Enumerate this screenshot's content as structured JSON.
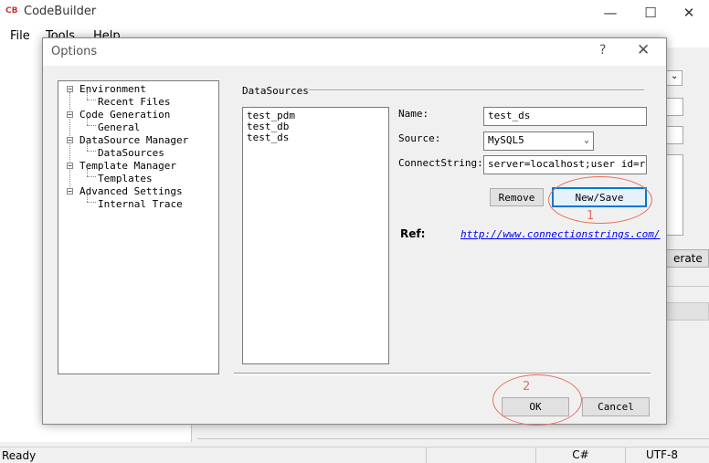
{
  "app": {
    "title": "CodeBuilder",
    "icon_text": "CB",
    "window_controls": {
      "minimize": "—",
      "maximize": "☐",
      "close": "✕"
    }
  },
  "menu": [
    "File",
    "Tools",
    "Help"
  ],
  "background": {
    "generate_button_partial": "erate"
  },
  "status_bar": {
    "status": "Ready",
    "language": "C#",
    "encoding": "UTF-8"
  },
  "dialog": {
    "title": "Options",
    "help": "?",
    "close": "✕",
    "tree": [
      {
        "label": "Environment",
        "children": [
          "Recent Files"
        ]
      },
      {
        "label": "Code Generation",
        "children": [
          "General"
        ]
      },
      {
        "label": "DataSource Manager",
        "children": [
          "DataSources"
        ]
      },
      {
        "label": "Template Manager",
        "children": [
          "Templates"
        ]
      },
      {
        "label": "Advanced Settings",
        "children": [
          "Internal Trace"
        ]
      }
    ],
    "group_title": "DataSources",
    "datasources": [
      "test_pdm",
      "test_db",
      "test_ds"
    ],
    "fields": {
      "name_label": "Name:",
      "name_value": "test_ds",
      "source_label": "Source:",
      "source_value": "MySQL5",
      "connect_label": "ConnectString:",
      "connect_value": "server=localhost;user id=root"
    },
    "buttons": {
      "remove": "Remove",
      "new_save": "New/Save",
      "ok": "OK",
      "cancel": "Cancel"
    },
    "ref": {
      "label": "Ref:",
      "link": "http://www.connectionstrings.com/"
    },
    "annotations": {
      "first": "1",
      "second": "2",
      "color": "#e8705a"
    }
  }
}
